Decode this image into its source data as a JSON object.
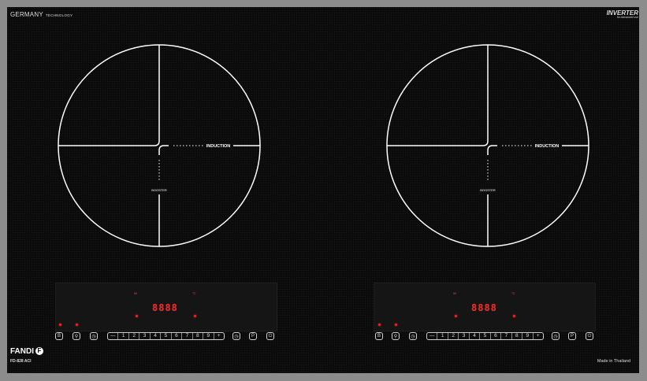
{
  "brand": {
    "name": "GERMANY",
    "tech": "TECHNOLOGY",
    "inverter": "INVERTER",
    "inverter_sub": "for Advanced use"
  },
  "zones": [
    {
      "label_induction": "INDUCTION",
      "label_booster": "BOOSTER"
    },
    {
      "label_induction": "INDUCTION",
      "label_booster": "BOOSTER"
    }
  ],
  "controls": [
    {
      "display": "8888",
      "slider": [
        "—",
        "1",
        "2",
        "3",
        "4",
        "5",
        "6",
        "7",
        "8",
        "9",
        "+"
      ]
    },
    {
      "display": "8888",
      "slider": [
        "—",
        "1",
        "2",
        "3",
        "4",
        "5",
        "6",
        "7",
        "8",
        "9",
        "+"
      ]
    }
  ],
  "keys": {
    "b": "B",
    "lock": "⚲",
    "timer": "◷",
    "pause": "◷",
    "p": "P",
    "power": "⏻"
  },
  "footer": {
    "logo": "FANDI",
    "logo_mark": "F",
    "model": "FD-828 ACI",
    "made": "Made in Thailand"
  },
  "colors": {
    "glass": "#0b0b0b",
    "frame": "#8c8c8c",
    "led": "#ff2a2a",
    "line": "#ffffff"
  }
}
